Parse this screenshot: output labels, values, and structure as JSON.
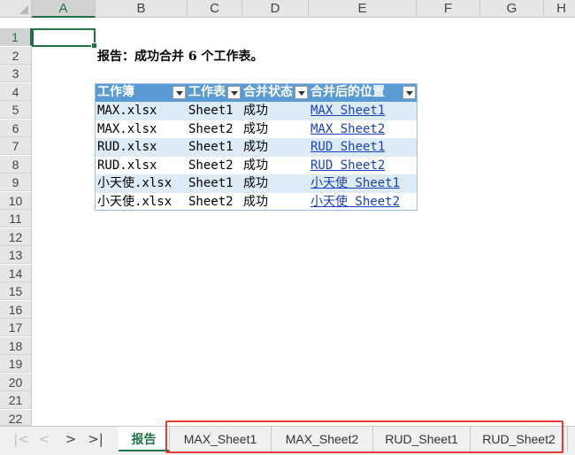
{
  "columns": [
    "A",
    "B",
    "C",
    "D",
    "E",
    "F",
    "G",
    "H"
  ],
  "rows": [
    "1",
    "2",
    "3",
    "4",
    "5",
    "6",
    "7",
    "8",
    "9",
    "10",
    "11",
    "12",
    "13",
    "14",
    "15",
    "16",
    "17",
    "18",
    "19",
    "20",
    "21",
    "22"
  ],
  "report_text": "报告：成功合并 6 个工作表。",
  "table": {
    "headers": [
      "工作簿",
      "工作表",
      "合并状态",
      "合并后的位置"
    ],
    "rows": [
      {
        "workbook": "MAX.xlsx",
        "sheet": "Sheet1",
        "status": "成功",
        "location": "MAX Sheet1"
      },
      {
        "workbook": "MAX.xlsx",
        "sheet": "Sheet2",
        "status": "成功",
        "location": "MAX Sheet2"
      },
      {
        "workbook": "RUD.xlsx",
        "sheet": "Sheet1",
        "status": "成功",
        "location": "RUD Sheet1"
      },
      {
        "workbook": "RUD.xlsx",
        "sheet": "Sheet2",
        "status": "成功",
        "location": "RUD Sheet2"
      },
      {
        "workbook": "小天使.xlsx",
        "sheet": "Sheet1",
        "status": "成功",
        "location": "小天使 Sheet1"
      },
      {
        "workbook": "小天使.xlsx",
        "sheet": "Sheet2",
        "status": "成功",
        "location": "小天使 Sheet2"
      }
    ]
  },
  "nav": {
    "first": "|<",
    "prev": "<",
    "next": ">",
    "last": ">|"
  },
  "sheet_tabs": [
    "报告",
    "MAX_Sheet1",
    "MAX_Sheet2",
    "RUD_Sheet1",
    "RUD_Sheet2"
  ],
  "active_tab": "报告",
  "selected_cell": "A1",
  "colors": {
    "accent": "#217346",
    "table_header": "#5b9bd5",
    "band": "#ddebf7",
    "link": "#1a3fbf",
    "highlight": "#e53935"
  }
}
